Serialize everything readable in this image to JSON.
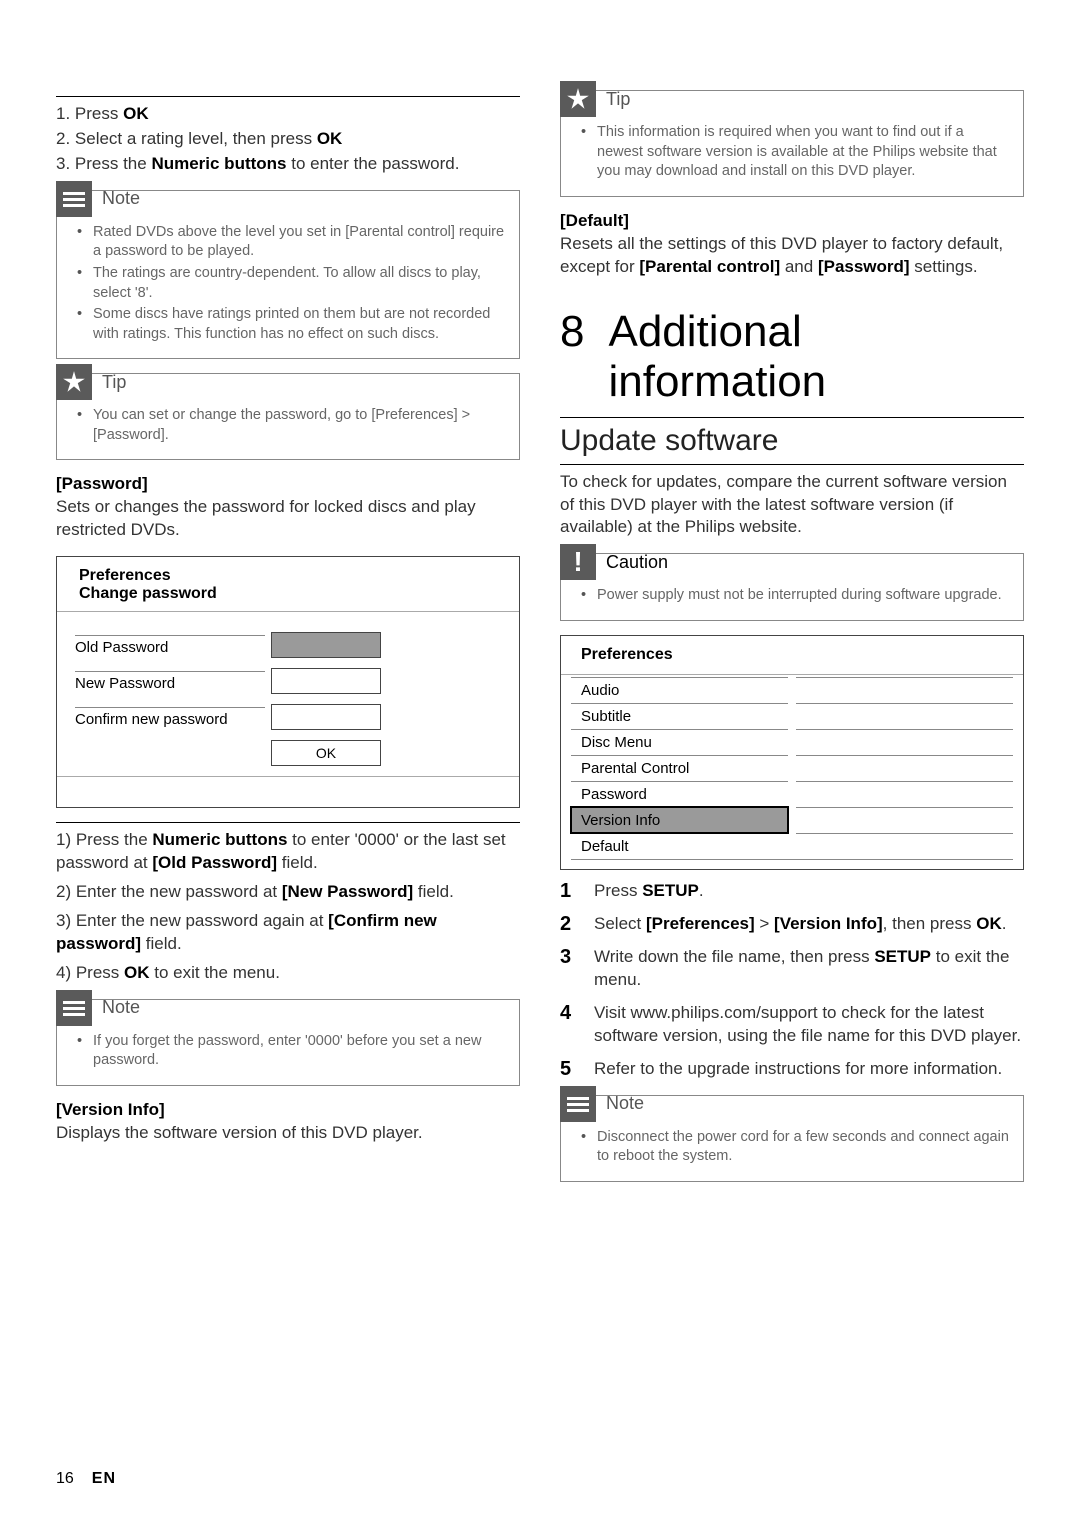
{
  "left": {
    "rule": true,
    "steps": {
      "s1a": "1. Press ",
      "s1b": "OK",
      "s2a": "2. Select a rating level, then press ",
      "s2b": "OK",
      "s3a": "3. Press the ",
      "s3b": "Numeric buttons",
      "s3c": " to enter the password."
    },
    "note1": {
      "title": "Note",
      "items": [
        "Rated DVDs above the level you set in [Parental control] require a password to be played.",
        "The ratings are country-dependent. To allow all discs to play, select '8'.",
        "Some discs have ratings printed on them but are not recorded with ratings. This function has no effect on such discs."
      ]
    },
    "tip1": {
      "title": "Tip",
      "items": [
        "You can set or change the password, go to [Preferences] > [Password]."
      ]
    },
    "password_head": "[Password]",
    "password_desc": "Sets or changes the password for locked discs and play restricted DVDs.",
    "pw_screen": {
      "title": "Preferences",
      "subtitle": "Change password",
      "old": "Old Password",
      "new": "New Password",
      "confirm": "Confirm new password",
      "ok": "OK"
    },
    "pw_steps": {
      "l1": "1) Press the Numeric buttons to enter '0000' or the last set password at [Old Password] field.",
      "l2": "2) Enter the new password at [New Password] field.",
      "l3": "3) Enter the new password again at [Confirm new password] field.",
      "l4": "4) Press OK to exit the menu."
    },
    "note2": {
      "title": "Note",
      "items": [
        "If you forget the password, enter '0000' before you set a new password."
      ]
    },
    "version_head": "[Version Info]",
    "version_desc": "Displays the software version of this DVD player."
  },
  "right": {
    "tip2": {
      "title": "Tip",
      "items": [
        "This information is required when you want to find out if a newest software version is available at the Philips website that you may download and install on this DVD player."
      ]
    },
    "default_head": "[Default]",
    "default_desc_a": "Resets all the settings of this DVD player to factory default, except for ",
    "default_desc_b": "[Parental control]",
    "default_desc_c": " and ",
    "default_desc_d": "[Password]",
    "default_desc_e": " settings.",
    "h1_num": "8",
    "h1_text": "Additional information",
    "h2": "Update software",
    "update_desc": "To check for updates, compare the current software version of this DVD player with the latest software version (if available) at the Philips website.",
    "caution": {
      "title": "Caution",
      "items": [
        "Power supply must not be interrupted during software upgrade."
      ]
    },
    "prefs": {
      "title": "Preferences",
      "rows": [
        "Audio",
        "Subtitle",
        "Disc Menu",
        "Parental Control",
        "Password",
        "Version Info",
        "Default"
      ],
      "selected_index": 5
    },
    "ol": [
      "Press SETUP.",
      "Select [Preferences] > [Version Info], then press OK.",
      "Write down the file name, then press SETUP to exit the menu.",
      "Visit www.philips.com/support to check for the latest software version, using the file name for this DVD player.",
      "Refer to the upgrade instructions for more information."
    ],
    "note3": {
      "title": "Note",
      "items": [
        "Disconnect the power cord for a few seconds and connect again to reboot the system."
      ]
    }
  },
  "footer": {
    "page": "16",
    "lang": "EN"
  }
}
